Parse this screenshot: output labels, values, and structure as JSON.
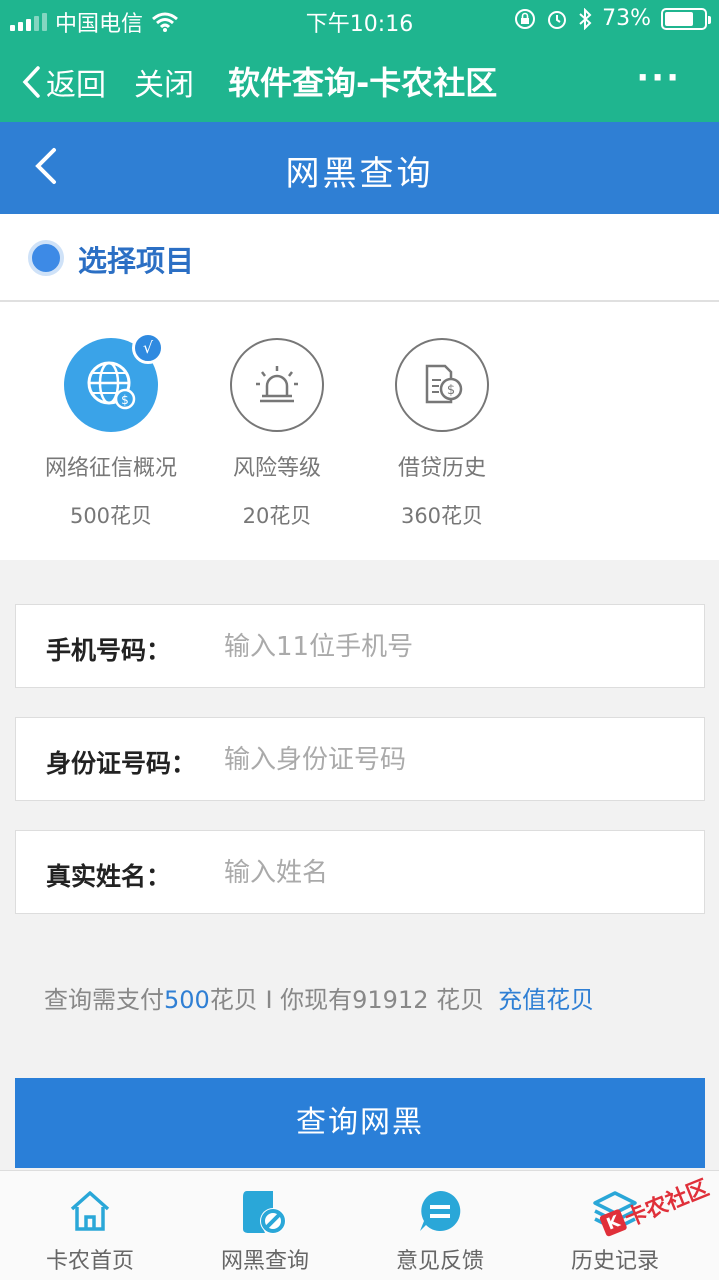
{
  "status_bar": {
    "carrier": "中国电信",
    "time": "下午10:16",
    "battery": "73%",
    "battery_level": 0.73
  },
  "wechat_bar": {
    "back_label": "返回",
    "close_label": "关闭",
    "title": "软件查询-卡农社区",
    "more_label": "···"
  },
  "nav": {
    "title": "网黑查询"
  },
  "section": {
    "label": "选择项目"
  },
  "items": [
    {
      "name": "网络征信概况",
      "price": "500花贝",
      "icon": "globe-dollar-icon",
      "selected": true,
      "check": "√"
    },
    {
      "name": "风险等级",
      "price": "20花贝",
      "icon": "alarm-light-icon",
      "selected": false
    },
    {
      "name": "借贷历史",
      "price": "360花贝",
      "icon": "loan-document-icon",
      "selected": false
    }
  ],
  "form": {
    "phone": {
      "label": "手机号码：",
      "placeholder": "输入11位手机号",
      "value": ""
    },
    "id_card": {
      "label": "身份证号码：",
      "placeholder": "输入身份证号码",
      "value": ""
    },
    "name": {
      "label": "真实姓名：",
      "placeholder": "输入姓名",
      "value": ""
    }
  },
  "payment": {
    "prefix": "查询需支付",
    "amount": "500",
    "middle": "花贝 I 你现有91912 花贝",
    "recharge_label": "充值花贝"
  },
  "submit_label": "查询网黑",
  "tabs": [
    {
      "label": "卡农首页",
      "icon": "home-icon"
    },
    {
      "label": "网黑查询",
      "icon": "blacklist-query-icon"
    },
    {
      "label": "意见反馈",
      "icon": "feedback-icon"
    },
    {
      "label": "历史记录",
      "icon": "history-layers-icon"
    }
  ],
  "watermark": "卡农社区",
  "watermark_mark": "K",
  "colors": {
    "wechat_green": "#1fb58f",
    "primary_blue": "#2f7fd4",
    "tab_icon_blue": "#2aa7d8"
  }
}
